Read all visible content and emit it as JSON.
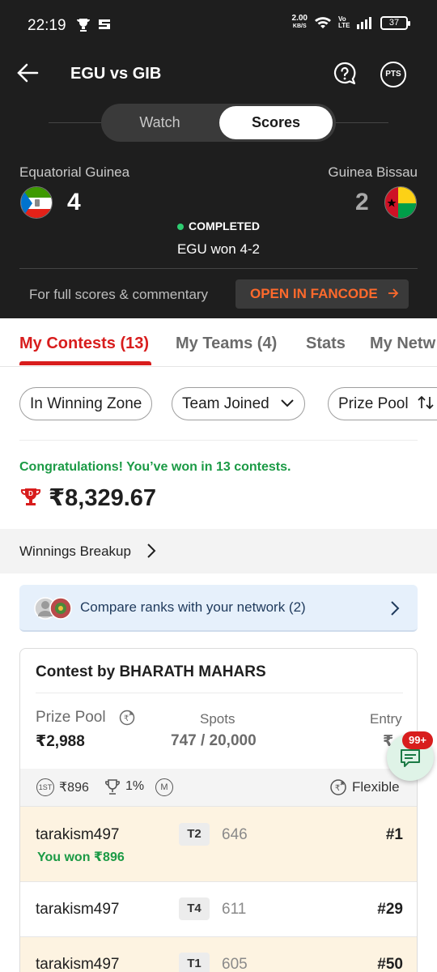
{
  "status_bar": {
    "time": "22:19",
    "speed_value": "2.00",
    "speed_unit": "KB/S",
    "volte": "Vo LTE",
    "battery": "37"
  },
  "header": {
    "title": "EGU vs GIB",
    "pts_label": "PTS"
  },
  "segment": {
    "watch": "Watch",
    "scores": "Scores"
  },
  "match": {
    "team_left": "Equatorial Guinea",
    "team_right": "Guinea Bissau",
    "score_left": "4",
    "score_right": "2",
    "status": "COMPLETED",
    "result": "EGU won 4-2",
    "full_scores_text": "For full scores & commentary",
    "fancode_button": "OPEN IN FANCODE",
    "status_color": "#2ecc71",
    "fancode_color": "#ff6a2c"
  },
  "tabs": [
    {
      "label": "My Contests (13)",
      "active": true
    },
    {
      "label": "My Teams (4)",
      "active": false
    },
    {
      "label": "Stats",
      "active": false
    },
    {
      "label": "My Netw",
      "active": false
    }
  ],
  "filters": {
    "in_winning_zone": "In Winning Zone",
    "team_joined": "Team Joined",
    "prize_pool": "Prize Pool"
  },
  "winnings": {
    "congrats": "Congratulations! You’ve won in 13 contests.",
    "total": "₹8,329.67",
    "breakup_label": "Winnings Breakup"
  },
  "compare": {
    "text": "Compare ranks with your network (2)"
  },
  "contest": {
    "title": "Contest by BHARATH MAHARS",
    "prize_pool_label": "Prize Pool",
    "prize_pool_value": "₹2,988",
    "spots_label": "Spots",
    "spots_value": "747 / 20,000",
    "entry_label": "Entry",
    "entry_value": "₹",
    "first_prize_badge": "1ST",
    "first_prize": "₹896",
    "winners_pct": "1%",
    "multi_badge": "M",
    "flexible": "Flexible",
    "rows": [
      {
        "name": "tarakism497",
        "won": "You won ₹896",
        "team": "T2",
        "points": "646",
        "rank": "#1"
      },
      {
        "name": "tarakism497",
        "won": "",
        "team": "T4",
        "points": "611",
        "rank": "#29"
      },
      {
        "name": "tarakism497",
        "won": "",
        "team": "T1",
        "points": "605",
        "rank": "#50"
      }
    ]
  },
  "chat": {
    "badge": "99+"
  },
  "colors": {
    "brand_red": "#d81d1d",
    "win_green": "#1b9a45",
    "dark_bg": "#1e1e1e"
  }
}
